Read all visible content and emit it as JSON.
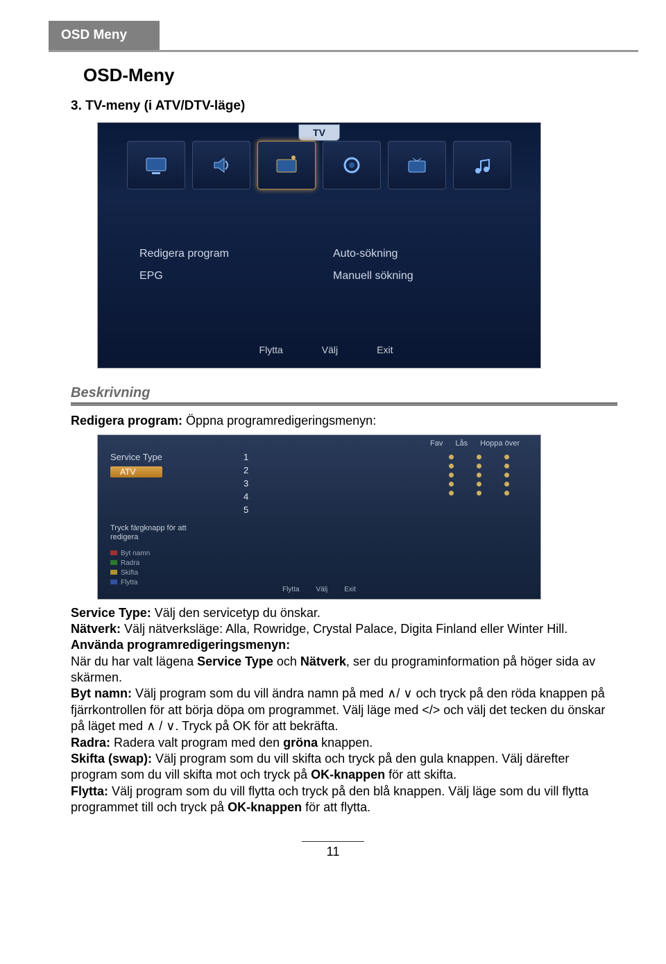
{
  "header": {
    "tab_label": "OSD Meny",
    "main_heading": "OSD-Meny",
    "section_heading": "3. TV-meny (i ATV/DTV-läge)"
  },
  "screenshot1": {
    "tab": "TV",
    "menu": {
      "redigera": "Redigera program",
      "auto": "Auto-sökning",
      "epg": "EPG",
      "manuell": "Manuell sökning"
    },
    "footer": {
      "flytta": "Flytta",
      "valj": "Välj",
      "exit": "Exit"
    }
  },
  "desc_label": "Beskrivning",
  "desc_line1_bold": "Redigera program:",
  "desc_line1_rest": " Öppna programredigeringsmenyn:",
  "screenshot2": {
    "service_type": "Service Type",
    "atv": "ATV",
    "header": {
      "fav": "Fav",
      "las": "Lås",
      "hoppa": "Hoppa över"
    },
    "nums": [
      "1",
      "2",
      "3",
      "4",
      "5"
    ],
    "hint": "Tryck färgknapp för att redigera",
    "legend": [
      "Byt namn",
      "Radra",
      "Skifta",
      "Flytta"
    ],
    "footer": {
      "flytta": "Flytta",
      "valj": "Välj",
      "exit": "Exit"
    }
  },
  "body": {
    "p1_bold": "Service Type:",
    "p1_rest": " Välj den servicetyp du önskar.",
    "p2_bold": "Nätverk:",
    "p2_rest": " Välj nätverksläge: Alla, Rowridge, Crystal Palace, Digita Finland eller Winter Hill.",
    "p3_bold": "Använda programredigeringsmenyn:",
    "p4_a": "När du har valt lägena ",
    "p4_b": "Service Type",
    "p4_c": " och ",
    "p4_d": "Nätverk",
    "p4_e": ", ser du programinformation på höger sida av skärmen.",
    "p5_bold": "Byt namn:",
    "p5_a": " Välj program som du vill ändra namn på med ",
    "p5_b": " och tryck på den röda knappen på fjärrkontrollen för att börja döpa om programmet. Välj läge med </> och välj det tecken du önskar på läget med ",
    "p5_c": ". Tryck på OK för att bekräfta.",
    "p6_bold": "Radra:",
    "p6_a": " Radera valt program med den ",
    "p6_b": "gröna",
    "p6_c": " knappen.",
    "p7_bold": "Skifta (swap):",
    "p7_a": " Välj program som du vill skifta och tryck på den gula knappen. Välj därefter program som du vill skifta mot och tryck på ",
    "p7_b": "OK-knappen",
    "p7_c": " för att skifta.",
    "p8_bold": "Flytta:",
    "p8_a": " Välj program som du vill flytta och tryck på den blå knappen. Välj läge som du vill flytta programmet till och tryck på ",
    "p8_b": "OK-knappen",
    "p8_c": " för att flytta."
  },
  "page_number": "11"
}
